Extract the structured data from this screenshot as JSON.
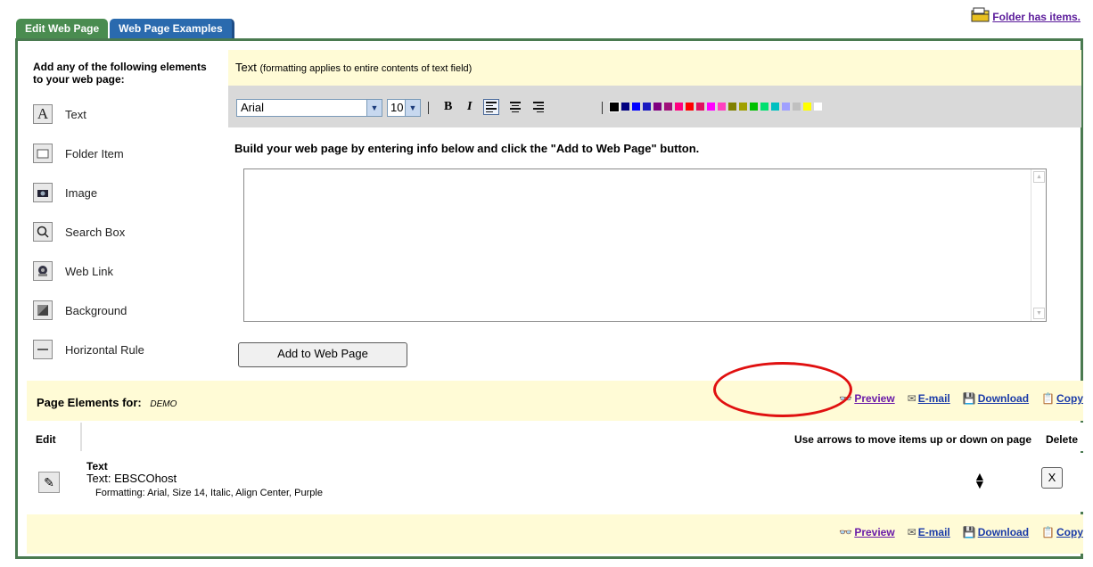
{
  "tabs": [
    {
      "label": "Edit Web Page",
      "active": true
    },
    {
      "label": "Web Page Examples",
      "active": false
    }
  ],
  "folder_link": "Folder has items.",
  "sidebar": {
    "heading": "Add any of the following elements to your web page:",
    "items": [
      {
        "label": "Text",
        "icon": "text-A-icon"
      },
      {
        "label": "Folder Item",
        "icon": "folder-item-icon"
      },
      {
        "label": "Image",
        "icon": "camera-icon"
      },
      {
        "label": "Search Box",
        "icon": "magnifier-icon"
      },
      {
        "label": "Web Link",
        "icon": "globe-link-icon"
      },
      {
        "label": "Background",
        "icon": "background-icon"
      },
      {
        "label": "Horizontal Rule",
        "icon": "horizontal-rule-icon"
      }
    ]
  },
  "editor": {
    "title": "Text",
    "title_note": "(formatting applies to entire contents of text field)",
    "font": "Arial",
    "size": "10",
    "bold": "B",
    "italic": "I",
    "colors": [
      "#000000",
      "#000080",
      "#0000ff",
      "#1a1ac0",
      "#800080",
      "#a0107a",
      "#ff0080",
      "#ff0000",
      "#e01060",
      "#ff00ff",
      "#ff40c0",
      "#808000",
      "#a0a000",
      "#00c000",
      "#00e070",
      "#00c0c0",
      "#a0a0ff",
      "#c0c0c0",
      "#ffff00",
      "#ffffff"
    ],
    "instructions": "Build your web page by entering info below and click the \"Add to Web Page\" button.",
    "add_button": "Add to Web Page"
  },
  "page_elements": {
    "label": "Page Elements for:",
    "name": "DEMO",
    "actions": [
      "Preview",
      "E-mail",
      "Download",
      "Copy"
    ],
    "headers": {
      "edit": "Edit",
      "arrows": "Use arrows to move items up or down on page",
      "delete": "Delete"
    },
    "rows": [
      {
        "type": "Text",
        "content": "Text: EBSCOhost",
        "formatting": "Formatting: Arial, Size 14, Italic, Align Center, Purple",
        "delete_label": "X"
      }
    ]
  }
}
